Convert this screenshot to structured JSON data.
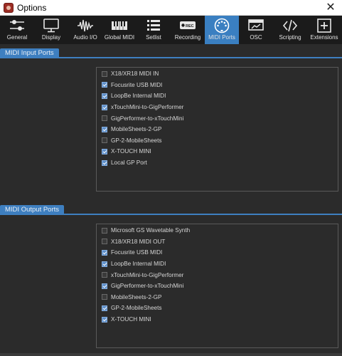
{
  "window": {
    "title": "Options",
    "close_glyph": "✕"
  },
  "toolbar": {
    "tabs": [
      {
        "label": "General",
        "icon": "sliders-icon",
        "active": false
      },
      {
        "label": "Display",
        "icon": "monitor-icon",
        "active": false
      },
      {
        "label": "Audio I/O",
        "icon": "waveform-icon",
        "active": false
      },
      {
        "label": "Global MIDI",
        "icon": "keyboard-icon",
        "active": false
      },
      {
        "label": "Setlist",
        "icon": "list-icon",
        "active": false
      },
      {
        "label": "Recording",
        "icon": "rec-icon",
        "active": false
      },
      {
        "label": "MIDI Ports",
        "icon": "midi-din-icon",
        "active": true
      },
      {
        "label": "OSC",
        "icon": "osc-icon",
        "active": false
      },
      {
        "label": "Scripting",
        "icon": "code-icon",
        "active": false
      },
      {
        "label": "Extensions",
        "icon": "plus-icon",
        "active": false
      }
    ],
    "rec_badge": "REC"
  },
  "midi_input": {
    "header": "MIDI Input Ports",
    "ports": [
      {
        "name": "X18/XR18 MIDI IN",
        "checked": false
      },
      {
        "name": "Focusrite USB MIDI",
        "checked": true
      },
      {
        "name": "LoopBe Internal MIDI",
        "checked": true
      },
      {
        "name": "xTouchMini-to-GigPerformer",
        "checked": true
      },
      {
        "name": "GigPerformer-to-xTouchMini",
        "checked": false
      },
      {
        "name": "MobileSheets-2-GP",
        "checked": true
      },
      {
        "name": "GP-2-MobileSheets",
        "checked": false
      },
      {
        "name": "X-TOUCH MINI",
        "checked": true
      },
      {
        "name": "Local GP Port",
        "checked": true
      }
    ]
  },
  "midi_output": {
    "header": "MIDI Output Ports",
    "ports": [
      {
        "name": "Microsoft GS Wavetable Synth",
        "checked": false
      },
      {
        "name": "X18/XR18 MIDI OUT",
        "checked": false
      },
      {
        "name": "Focusrite USB MIDI",
        "checked": true
      },
      {
        "name": "LoopBe Internal MIDI",
        "checked": true
      },
      {
        "name": "xTouchMini-to-GigPerformer",
        "checked": false
      },
      {
        "name": "GigPerformer-to-xTouchMini",
        "checked": true
      },
      {
        "name": "MobileSheets-2-GP",
        "checked": false
      },
      {
        "name": "GP-2-MobileSheets",
        "checked": true
      },
      {
        "name": "X-TOUCH MINI",
        "checked": true
      }
    ]
  },
  "colors": {
    "accent": "#3e7fc0",
    "background": "#2b2b2b",
    "toolbar": "#1b1b1b"
  }
}
